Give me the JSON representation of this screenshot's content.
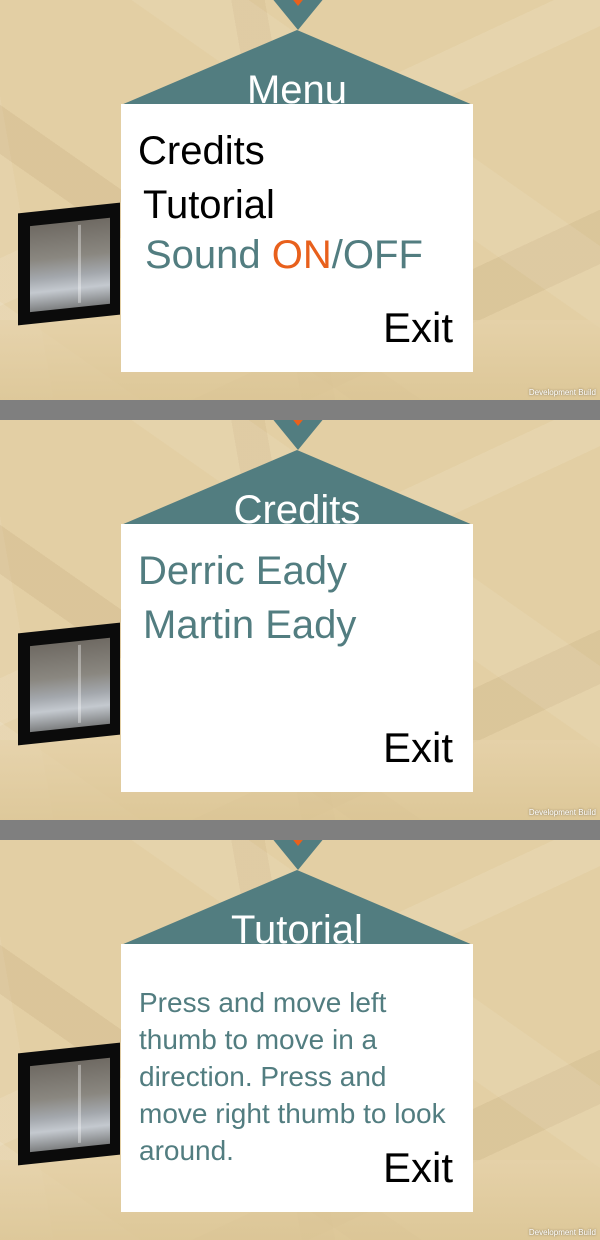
{
  "menu_panel": {
    "title": "Menu",
    "items": [
      "Credits",
      "Tutorial"
    ],
    "sound": {
      "label": "Sound ",
      "on": "ON",
      "separator": "/",
      "off": "OFF"
    },
    "exit_label": "Exit",
    "dev_build": "Development Build"
  },
  "credits_panel": {
    "title": "Credits",
    "names": [
      "Derric Eady",
      "Martin Eady"
    ],
    "exit_label": "Exit",
    "dev_build": "Development Build"
  },
  "tutorial_panel": {
    "title": "Tutorial",
    "text": "Press and move left thumb to move in a direction. Press and move right thumb to look around.",
    "exit_label": "Exit",
    "dev_build": "Development Build"
  },
  "colors": {
    "teal": "#527d80",
    "orange": "#e8601c",
    "background": "#e3cfa4",
    "separator": "#7f7f7f"
  },
  "icons": {
    "top_marker": "chevron-down-icon",
    "wall_screen": "wall-screen-image"
  }
}
